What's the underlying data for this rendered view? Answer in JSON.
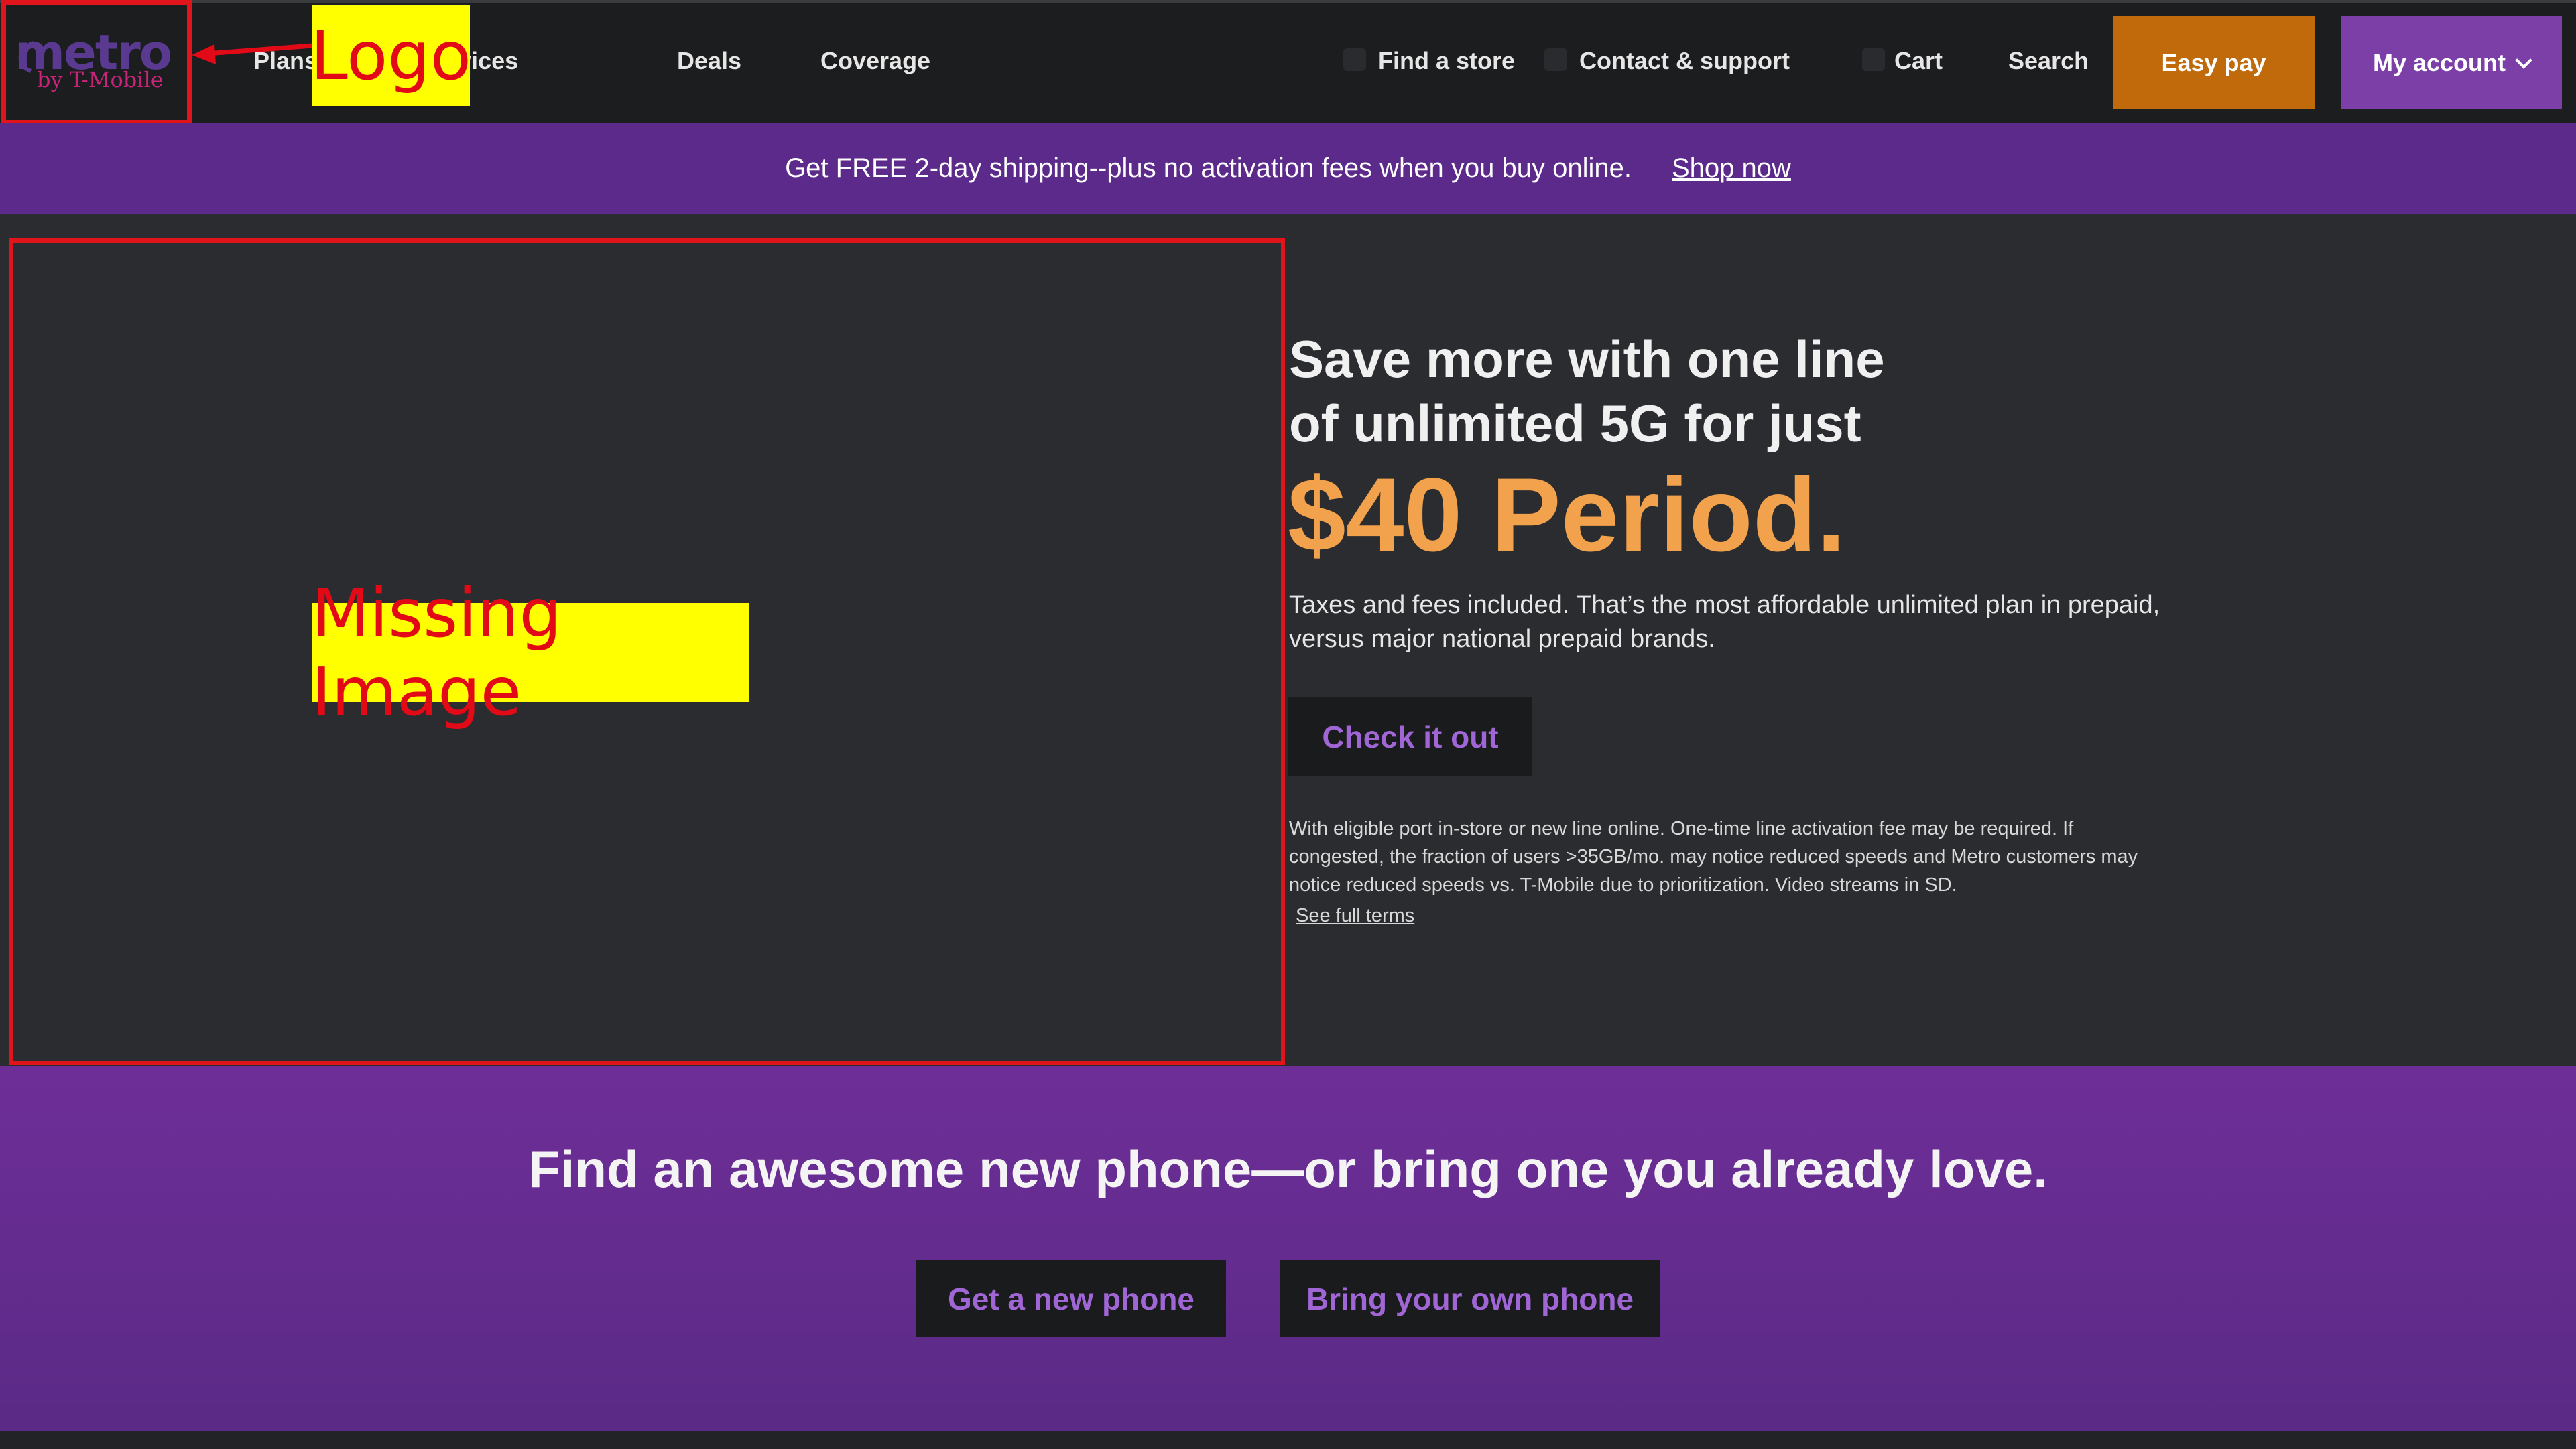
{
  "header": {
    "logo": {
      "word": "metro",
      "sub": "by T-Mobile"
    },
    "nav_left": [
      "Plans",
      "Phones & devices",
      "Deals",
      "Coverage"
    ],
    "nav_right": [
      "Find a store",
      "Contact & support",
      "Cart",
      "Search"
    ],
    "easy_pay": "Easy pay",
    "my_account": "My account"
  },
  "annotations": {
    "logo_label": "Logo",
    "missing_label": "Missing Image"
  },
  "promo": {
    "text": "Get FREE 2-day shipping--plus no activation fees when you buy online.",
    "link": "Shop now"
  },
  "hero": {
    "headline_line1": "Save more with one line",
    "headline_line2": "of unlimited 5G for just",
    "price": "$40 Period.",
    "subtext": "Taxes and fees included. That’s the most affordable unlimited plan in prepaid, versus major national prepaid brands.",
    "cta": "Check it out",
    "fine_print": "With eligible port in-store or new line online. One-time line activation fee may be required. If congested, the fraction of users >35GB/mo. may notice reduced speeds and Metro customers may notice reduced speeds vs. T-Mobile due to prioritization. Video streams in SD.",
    "terms_link": "See full terms"
  },
  "phones": {
    "title": "Find an awesome new phone—or bring one you already love.",
    "new_phone": "Get a new phone",
    "byo_phone": "Bring your own phone"
  },
  "colors": {
    "accent_purple": "#7b3fa7",
    "promo_purple": "#5c2a8a",
    "easy_pay_orange": "#c06a0b",
    "price_orange": "#f2a24c",
    "annotation_red": "#e30a17",
    "annotation_yellow": "#ffff00"
  }
}
